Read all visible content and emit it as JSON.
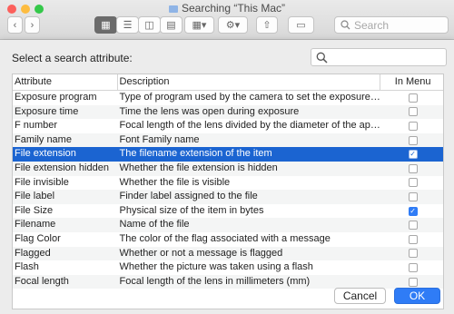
{
  "window": {
    "title": "Searching “This Mac”",
    "search_placeholder": "Search",
    "colors": {
      "close": "#fc605c",
      "minimize": "#fdbc40",
      "zoom": "#34c84a"
    }
  },
  "toolbar_icons": [
    "back-icon",
    "forward-icon",
    "icon-view-icon",
    "list-view-icon",
    "column-view-icon",
    "gallery-view-icon",
    "group-icon",
    "action-gear-icon",
    "share-icon",
    "tag-icon",
    "search-icon"
  ],
  "dialog": {
    "prompt": "Select a search attribute:",
    "search_value": "",
    "columns": {
      "attribute": "Attribute",
      "description": "Description",
      "in_menu": "In Menu"
    },
    "rows": [
      {
        "attribute": "Exposure program",
        "description": "Type of program used by the camera to set the exposure:...",
        "in_menu": false
      },
      {
        "attribute": "Exposure time",
        "description": "Time the lens was open during exposure",
        "in_menu": false
      },
      {
        "attribute": "F number",
        "description": "Focal length of the lens divided by the diameter of the aper...",
        "in_menu": false
      },
      {
        "attribute": "Family name",
        "description": "Font Family name",
        "in_menu": false
      },
      {
        "attribute": "File extension",
        "description": "The filename extension of the item",
        "in_menu": true,
        "selected": true
      },
      {
        "attribute": "File extension hidden",
        "description": "Whether the file extension is hidden",
        "in_menu": false
      },
      {
        "attribute": "File invisible",
        "description": "Whether the file is visible",
        "in_menu": false
      },
      {
        "attribute": "File label",
        "description": "Finder label assigned to the file",
        "in_menu": false
      },
      {
        "attribute": "File Size",
        "description": "Physical size of the item in bytes",
        "in_menu": true
      },
      {
        "attribute": "Filename",
        "description": "Name of the file",
        "in_menu": false
      },
      {
        "attribute": "Flag Color",
        "description": "The color of the flag associated with a message",
        "in_menu": false
      },
      {
        "attribute": "Flagged",
        "description": "Whether or not a message is flagged",
        "in_menu": false
      },
      {
        "attribute": "Flash",
        "description": "Whether the picture was taken using a flash",
        "in_menu": false
      },
      {
        "attribute": "Focal length",
        "description": "Focal length of the lens in millimeters (mm)",
        "in_menu": false
      }
    ],
    "cancel_label": "Cancel",
    "ok_label": "OK",
    "accent_color": "#2f7cf6",
    "selection_color": "#1b64d1"
  }
}
